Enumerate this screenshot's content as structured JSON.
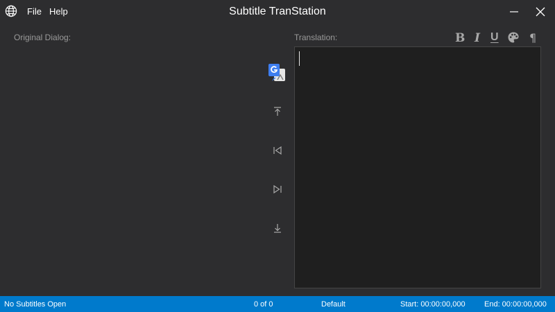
{
  "app": {
    "title": "Subtitle TranStation"
  },
  "menu": {
    "file": "File",
    "help": "Help"
  },
  "icons": {
    "language": "globe-icon",
    "minimize": "minimize-icon",
    "close": "close-icon",
    "translate": "google-translate-icon",
    "first": "jump-to-first-icon",
    "previous": "previous-icon",
    "next": "next-icon",
    "last": "jump-to-last-icon",
    "color": "palette-icon"
  },
  "labels": {
    "original": "Original Dialog:",
    "translation": "Translation:"
  },
  "format": {
    "bold": "B",
    "italic": "I",
    "underline": "U",
    "paragraph": "¶"
  },
  "editor": {
    "value": ""
  },
  "status": {
    "file": "No Subtitles Open",
    "count": "0 of 0",
    "style": "Default",
    "start": "Start: 00:00:00,000",
    "end": "End: 00:00:00,000"
  },
  "colors": {
    "background": "#2d2d2f",
    "editor": "#1f1f1f",
    "statusbar": "#007acc",
    "icon": "#a9a9a9"
  }
}
